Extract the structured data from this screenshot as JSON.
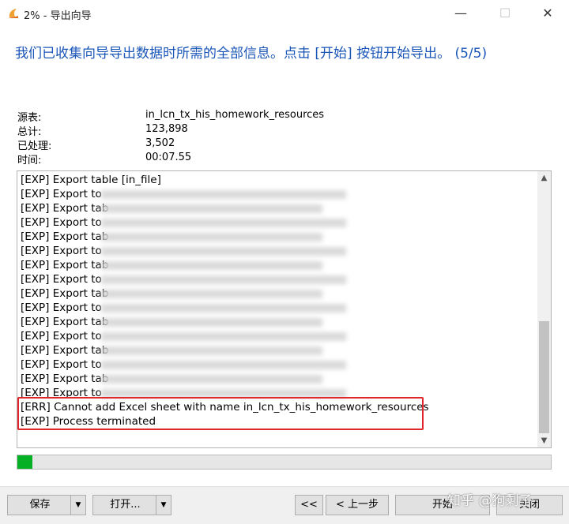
{
  "window": {
    "title": "2% - 导出向导",
    "minimize": "—",
    "maximize": "☐",
    "close": "✕"
  },
  "heading": "我们已收集向导导出数据时所需的全部信息。点击 [开始] 按钮开始导出。 (5/5)",
  "info": [
    {
      "label": "源表:",
      "value": "in_lcn_tx_his_homework_resources"
    },
    {
      "label": "总计:",
      "value": "123,898"
    },
    {
      "label": "已处理:",
      "value": "3,502"
    },
    {
      "label": "时间:",
      "value": "00:07.55"
    }
  ],
  "log": [
    "[EXP] Export table [in_file]",
    "[EXP] Export to",
    "[EXP] Export tab",
    "[EXP] Export to",
    "[EXP] Export tab",
    "[EXP] Export to",
    "[EXP] Export tab",
    "[EXP] Export to",
    "[EXP] Export tab",
    "[EXP] Export to",
    "[EXP] Export tab",
    "[EXP] Export to",
    "[EXP] Export tab",
    "[EXP] Export to",
    "[EXP] Export tab",
    "[EXP] Export to",
    "[ERR] Cannot add Excel sheet with name in_lcn_tx_his_homework_resources",
    "[EXP] Process terminated"
  ],
  "progress": {
    "percent": 2.8,
    "color": "#06b025"
  },
  "buttons": {
    "save": "保存",
    "open": "打开...",
    "first": "<<",
    "back": "< 上一步",
    "start": "开始",
    "close": "关闭",
    "arrow": "▼"
  },
  "scroll": {
    "up": "▲",
    "down": "▼"
  },
  "watermark": "知乎 @狗剩子",
  "colors": {
    "heading": "#1a56b8",
    "highlight": "#e0262b",
    "progress": "#06b025"
  }
}
